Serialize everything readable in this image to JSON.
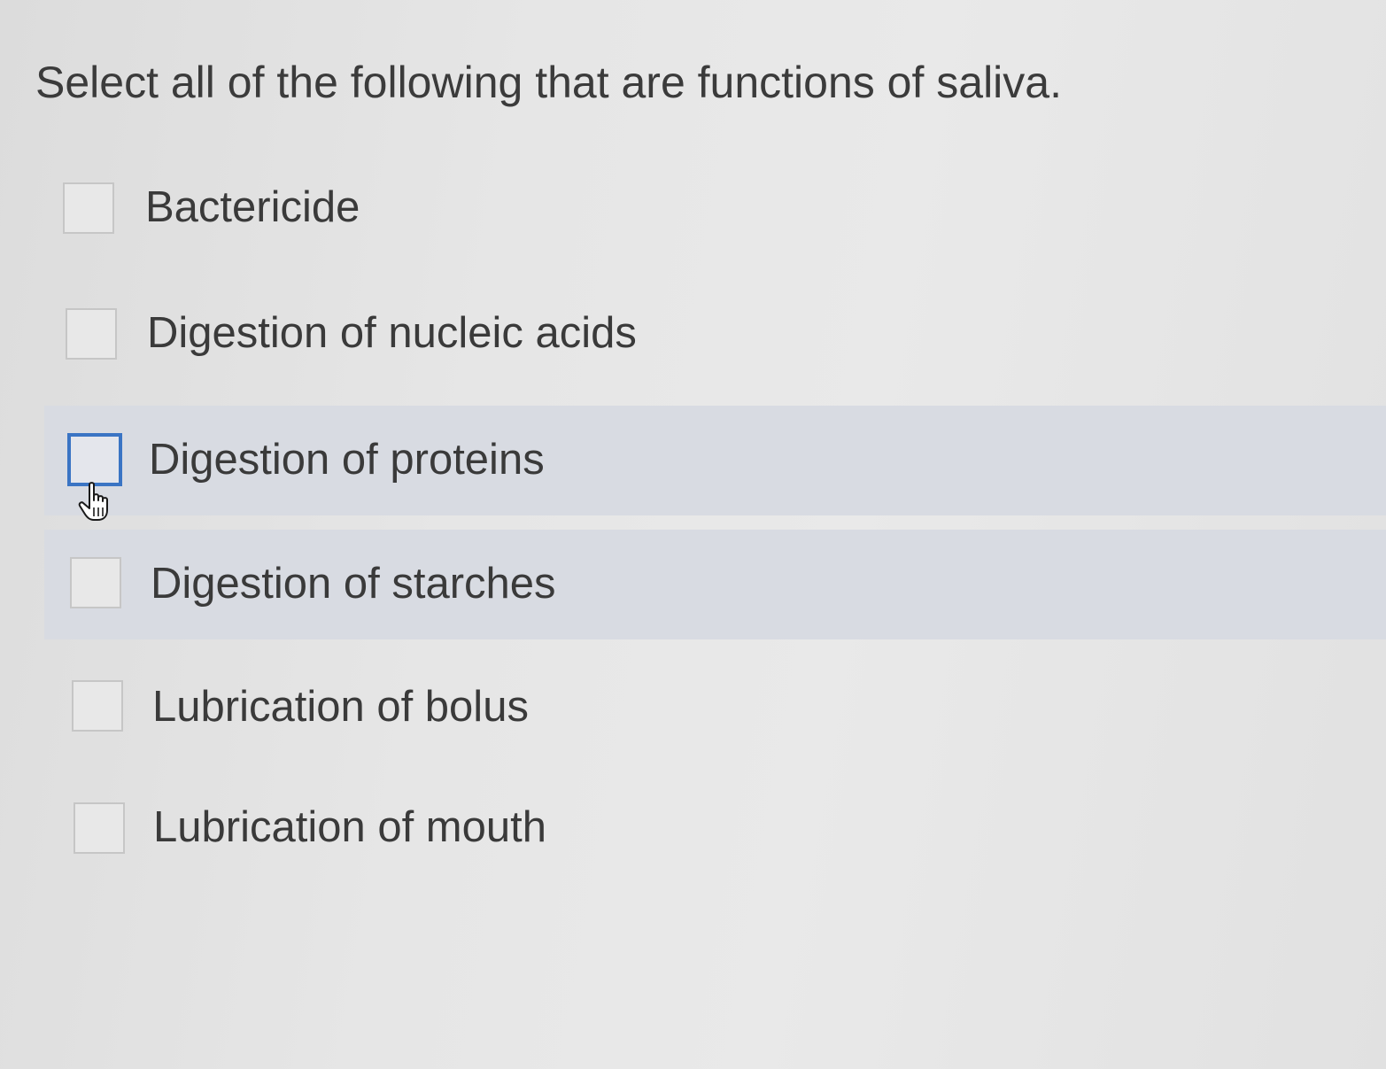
{
  "question": {
    "text": "Select all of the following that are functions of saliva."
  },
  "options": [
    {
      "label": "Bactericide",
      "checked": false
    },
    {
      "label": "Digestion of nucleic acids",
      "checked": false
    },
    {
      "label": "Digestion of proteins",
      "checked": false,
      "focused": true,
      "hovered": true
    },
    {
      "label": "Digestion of starches",
      "checked": false,
      "hovered": true
    },
    {
      "label": "Lubrication of bolus",
      "checked": false
    },
    {
      "label": "Lubrication of mouth",
      "checked": false
    }
  ],
  "colors": {
    "focus_border": "#3a74c4",
    "hover_row": "#d8dbe2",
    "text": "#3a3a3a"
  },
  "cursor": {
    "icon": "hand-pointer-icon"
  }
}
